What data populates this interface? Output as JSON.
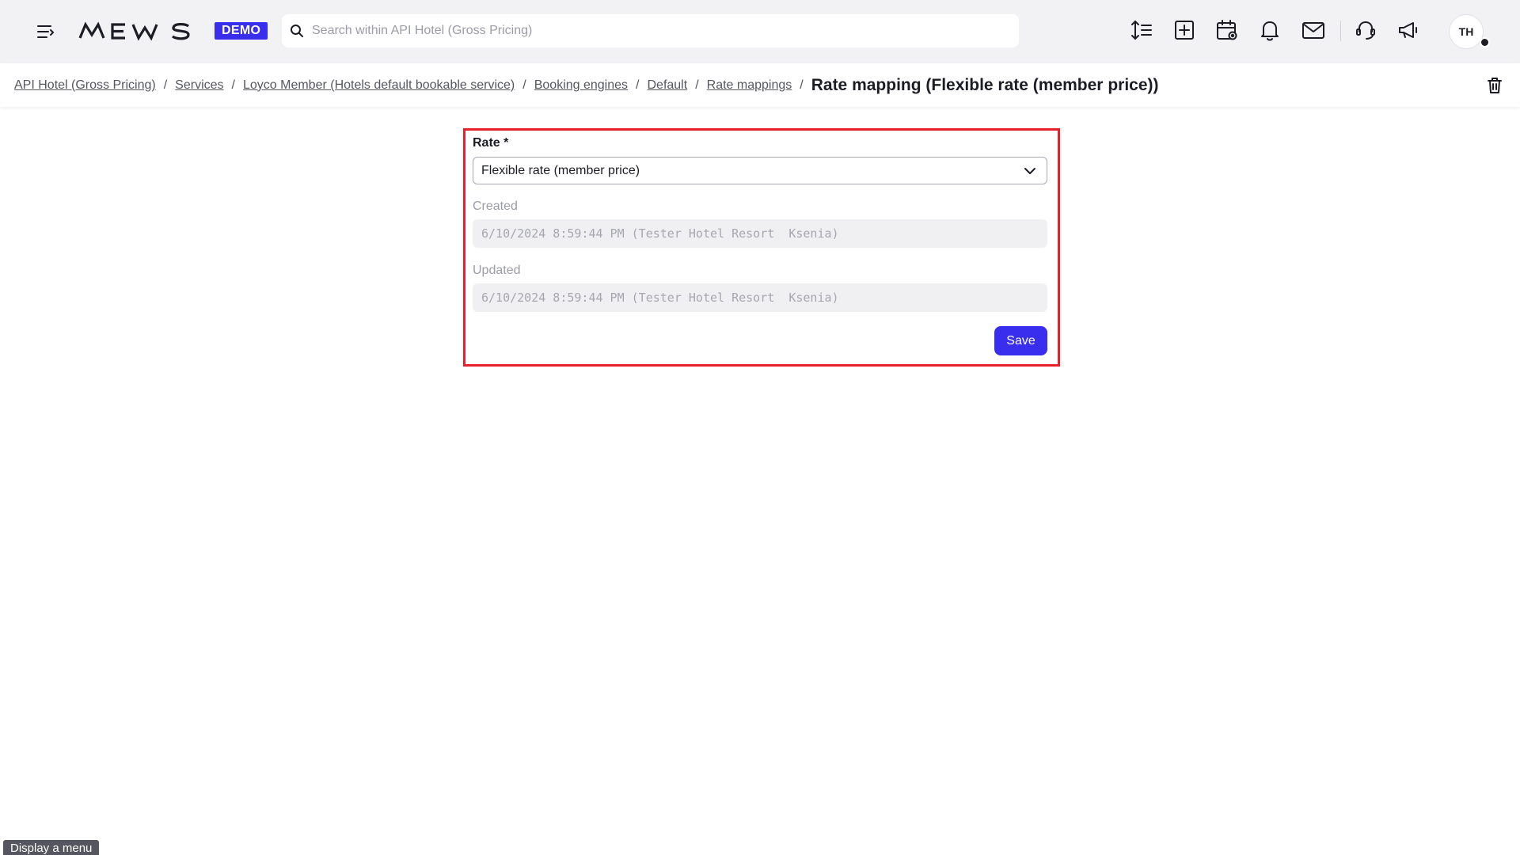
{
  "header": {
    "logo_text": "MEWS",
    "badge": "DEMO",
    "search": {
      "placeholder": "Search within API Hotel (Gross Pricing)",
      "value": ""
    },
    "icons": [
      "menu-toggle-icon",
      "sort-icon",
      "add-icon",
      "calendar-icon",
      "bell-icon",
      "mail-icon",
      "support-icon",
      "announcements-icon"
    ],
    "avatar_initials": "TH"
  },
  "breadcrumb": {
    "items": [
      "API Hotel (Gross Pricing)",
      "Services",
      "Loyco Member (Hotels default bookable service)",
      "Booking engines",
      "Default",
      "Rate mappings"
    ],
    "separator": "/",
    "current": "Rate mapping (Flexible rate (member price))"
  },
  "form": {
    "rate": {
      "label": "Rate *",
      "value": "Flexible rate (member price)"
    },
    "created": {
      "label": "Created",
      "value": "6/10/2024 8:59:44 PM (Tester Hotel Resort  Ksenia)"
    },
    "updated": {
      "label": "Updated",
      "value": "6/10/2024 8:59:44 PM (Tester Hotel Resort  Ksenia)"
    },
    "save_label": "Save"
  },
  "tooltip": "Display a menu",
  "colors": {
    "accent": "#3a2eee",
    "highlight_frame": "#e8202a",
    "topbar": "#f2f2f5"
  }
}
